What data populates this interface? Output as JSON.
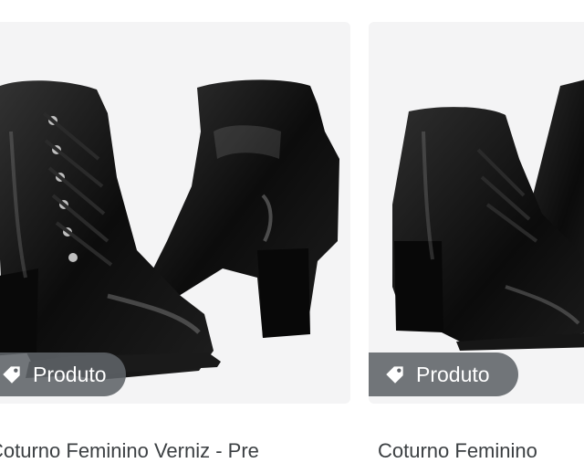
{
  "results": [
    {
      "title": "Coturno Feminino Verniz - Pre",
      "badge": "Produto"
    },
    {
      "title": "Coturno Feminino",
      "badge": "Produto"
    }
  ],
  "icons": {
    "badge": "tag-icon"
  }
}
